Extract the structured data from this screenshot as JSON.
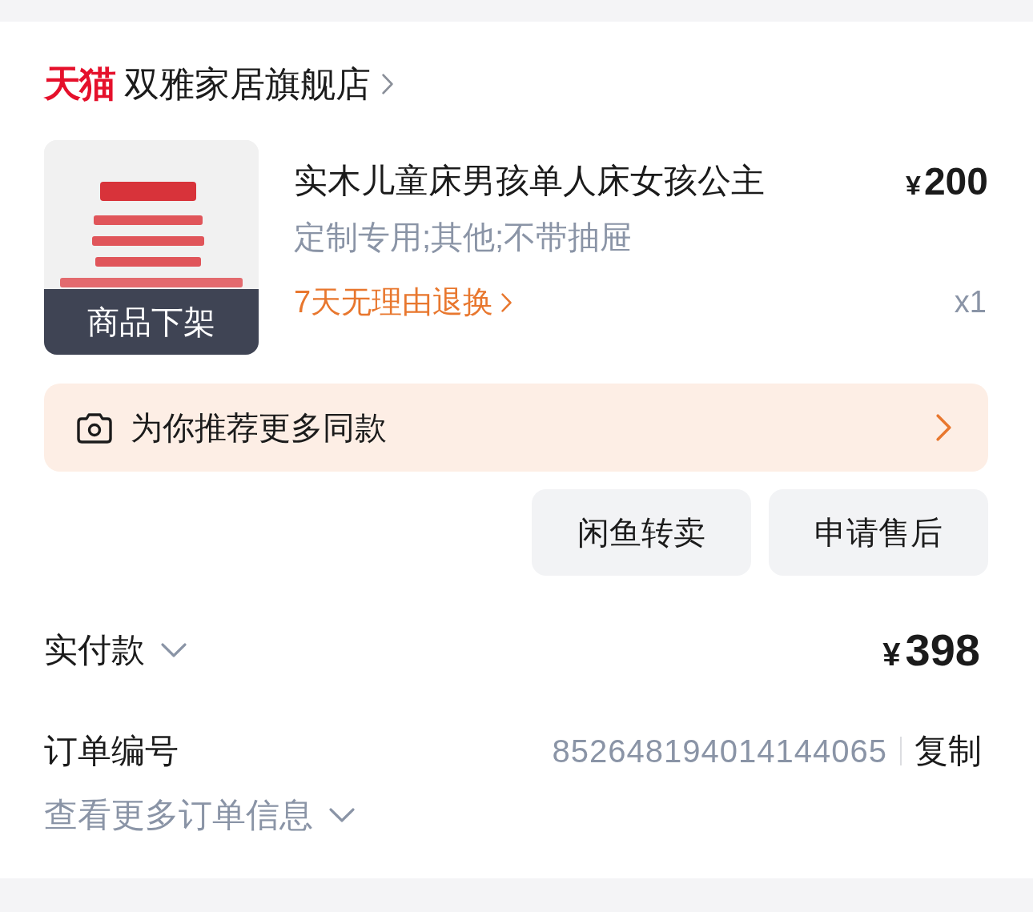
{
  "store": {
    "brand": "天猫",
    "name": "双雅家居旗舰店"
  },
  "product": {
    "image": {
      "kind": "picture",
      "overlay": "商品下架"
    },
    "title": "实木儿童床男孩单人床女孩公主",
    "price": {
      "currency": "¥",
      "amount": "200"
    },
    "spec": "定制专用;其他;不带抽屉",
    "service": "7天无理由退换",
    "quantity": "x1"
  },
  "recommend": {
    "label": "为你推荐更多同款"
  },
  "actions": [
    "闲鱼转卖",
    "申请售后"
  ],
  "payment": {
    "label": "实付款",
    "expanded": false,
    "amount": {
      "currency": "¥",
      "amount": "398"
    }
  },
  "order": {
    "label": "订单编号",
    "number": "852648194014144065",
    "copy": "复制",
    "more": "查看更多订单信息",
    "expanded": false
  }
}
